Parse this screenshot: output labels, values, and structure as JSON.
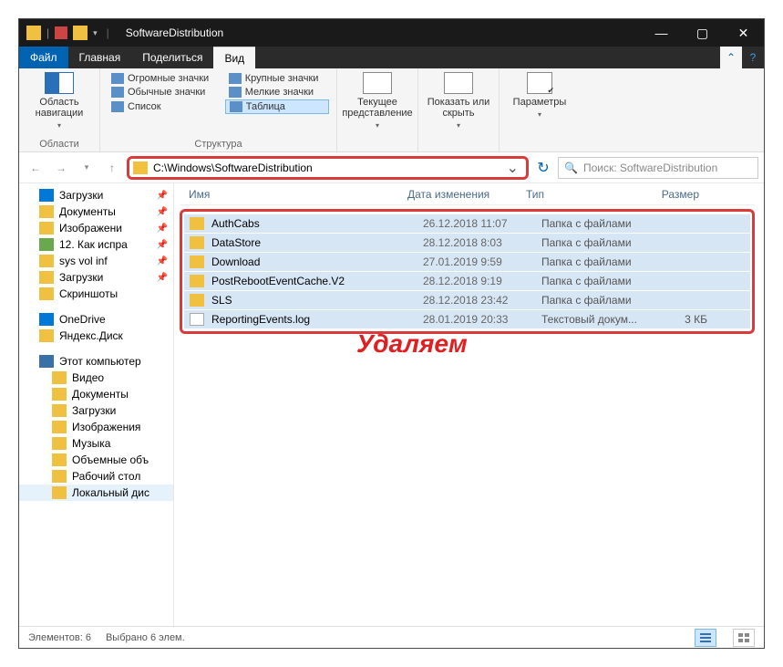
{
  "window": {
    "title": "SoftwareDistribution"
  },
  "menu": {
    "file": "Файл",
    "home": "Главная",
    "share": "Поделиться",
    "view": "Вид"
  },
  "ribbon": {
    "nav_pane": "Область навигации",
    "nav_group": "Области",
    "huge_icons": "Огромные значки",
    "large_icons": "Крупные значки",
    "normal_icons": "Обычные значки",
    "small_icons": "Мелкие значки",
    "list": "Список",
    "table": "Таблица",
    "layout_group": "Структура",
    "current_view": "Текущее представление",
    "show_hide": "Показать или скрыть",
    "options": "Параметры"
  },
  "address": {
    "path": "C:\\Windows\\SoftwareDistribution",
    "search_placeholder": "Поиск: SoftwareDistribution"
  },
  "tree": [
    {
      "icon": "bluef",
      "label": "Загрузки",
      "pin": true
    },
    {
      "icon": "fldr",
      "label": "Документы",
      "pin": true
    },
    {
      "icon": "fldr",
      "label": "Изображени",
      "pin": true
    },
    {
      "icon": "greenf",
      "label": "12. Как испра",
      "pin": true
    },
    {
      "icon": "fldr",
      "label": "sys vol inf",
      "pin": true
    },
    {
      "icon": "fldr",
      "label": "Загрузки",
      "pin": true
    },
    {
      "icon": "fldr",
      "label": "Скриншоты",
      "pin": false
    }
  ],
  "tree2": [
    {
      "icon": "bluef",
      "label": "OneDrive"
    },
    {
      "icon": "fldr",
      "label": "Яндекс.Диск"
    }
  ],
  "tree3_header": "Этот компьютер",
  "tree3": [
    {
      "label": "Видео"
    },
    {
      "label": "Документы"
    },
    {
      "label": "Загрузки"
    },
    {
      "label": "Изображения"
    },
    {
      "label": "Музыка"
    },
    {
      "label": "Объемные объ"
    },
    {
      "label": "Рабочий стол"
    },
    {
      "label": "Локальный дис",
      "sel": true
    }
  ],
  "columns": {
    "name": "Имя",
    "date": "Дата изменения",
    "type": "Тип",
    "size": "Размер"
  },
  "files": [
    {
      "name": "AuthCabs",
      "date": "26.12.2018 11:07",
      "type": "Папка с файлами",
      "size": "",
      "icon": "folder"
    },
    {
      "name": "DataStore",
      "date": "28.12.2018 8:03",
      "type": "Папка с файлами",
      "size": "",
      "icon": "folder"
    },
    {
      "name": "Download",
      "date": "27.01.2019 9:59",
      "type": "Папка с файлами",
      "size": "",
      "icon": "folder"
    },
    {
      "name": "PostRebootEventCache.V2",
      "date": "28.12.2018 9:19",
      "type": "Папка с файлами",
      "size": "",
      "icon": "folder"
    },
    {
      "name": "SLS",
      "date": "28.12.2018 23:42",
      "type": "Папка с файлами",
      "size": "",
      "icon": "folder"
    },
    {
      "name": "ReportingEvents.log",
      "date": "28.01.2019 20:33",
      "type": "Текстовый докум...",
      "size": "3 КБ",
      "icon": "file"
    }
  ],
  "annotation": "Удаляем",
  "statusbar": {
    "count": "Элементов: 6",
    "selected": "Выбрано 6 элем."
  }
}
